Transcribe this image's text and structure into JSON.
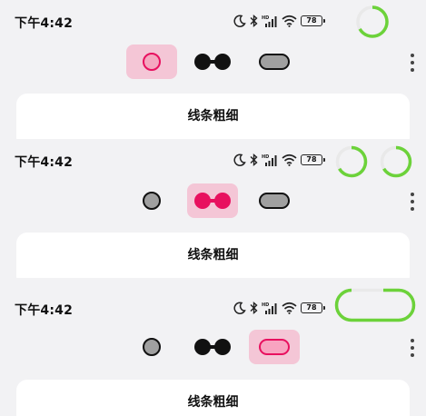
{
  "status_bar": {
    "time": "下午4:42",
    "battery": "78"
  },
  "card_title": "线条粗细",
  "panels": [
    {
      "selected_style": "hollow-circle"
    },
    {
      "selected_style": "dumbbell"
    },
    {
      "selected_style": "capsule"
    }
  ],
  "icons": [
    "moon-icon",
    "bluetooth-icon",
    "hd-signal-icon",
    "wifi-icon",
    "battery-icon",
    "overflow-menu-icon"
  ],
  "colors": {
    "accent": "#e8105f",
    "ring": "#6cd23a",
    "selection_bg": "#f4c6d6",
    "inactive_fill": "#a0a0a0"
  }
}
